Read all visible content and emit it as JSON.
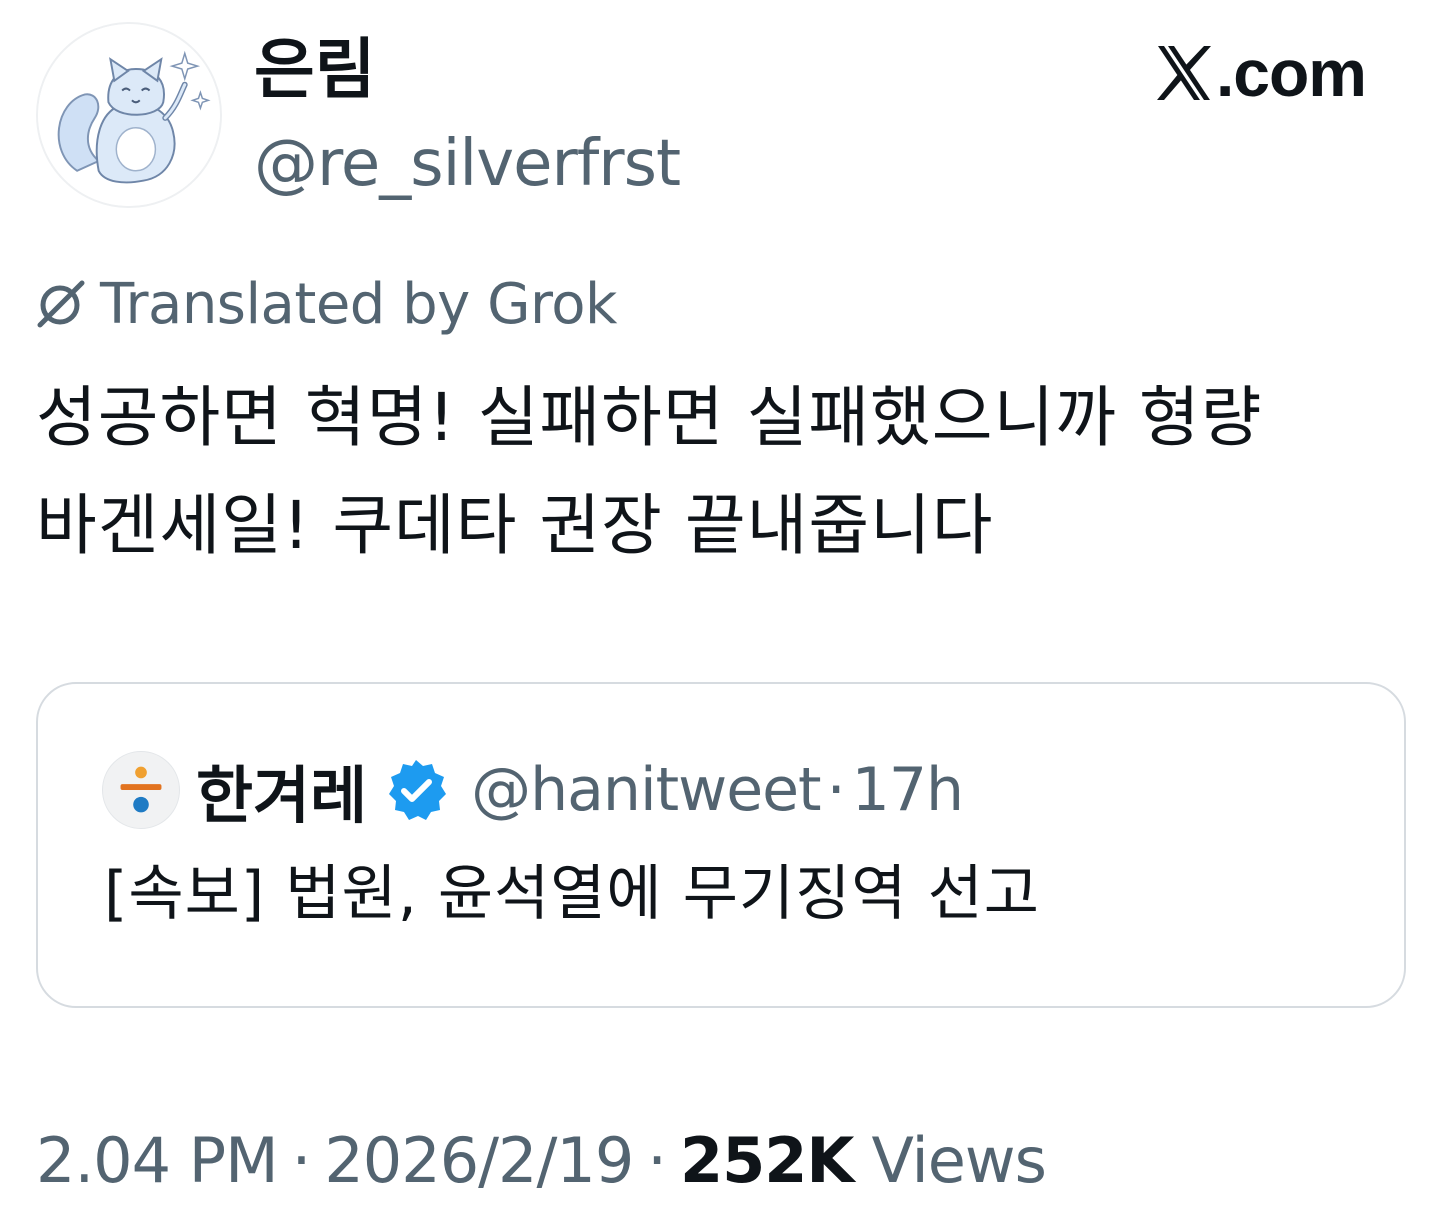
{
  "author": {
    "display_name": "은림",
    "handle": "@re_silverfrst",
    "avatar_icon": "cat-illustration-avatar"
  },
  "brand": {
    "logo_icon": "x-logo-icon",
    "domain_suffix": ".com"
  },
  "translation": {
    "icon": "grok-icon",
    "label": "Translated by Grok"
  },
  "tweet": {
    "text": "성공하면 혁명! 실패하면 실패했으니까 형량 바겐세일! 쿠데타 권장 끝내줍니다"
  },
  "quoted": {
    "avatar_icon": "hankyoreh-logo-icon",
    "display_name": "한겨레",
    "verified_icon": "verified-badge-icon",
    "handle": "@hanitweet",
    "separator": "·",
    "time": "17h",
    "text": "[속보] 법원, 윤석열에 무기징역 선고"
  },
  "meta": {
    "time": "2.04 PM",
    "separator": "·",
    "date": "2026/2/19",
    "views_count": "252K",
    "views_label": "Views"
  },
  "colors": {
    "text_primary": "#0f1419",
    "text_secondary": "#536471",
    "verified_blue": "#1d9bf0",
    "card_border": "#d6dbe0"
  }
}
